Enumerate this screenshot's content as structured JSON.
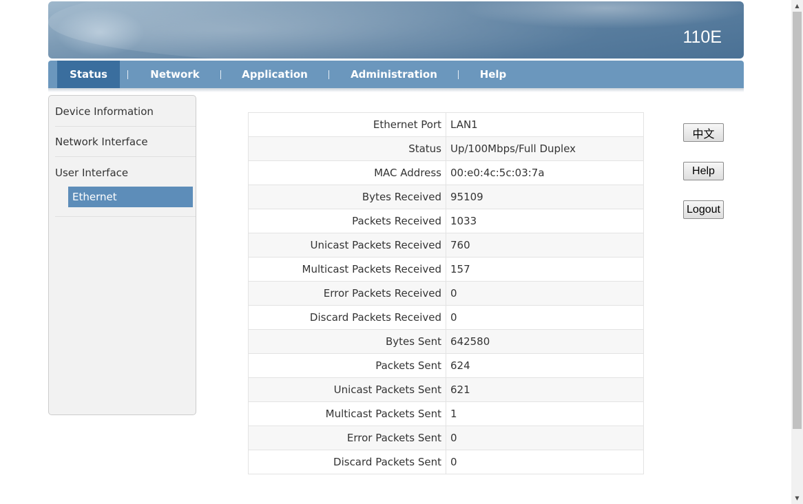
{
  "banner": {
    "model": "110E"
  },
  "nav": {
    "items": [
      {
        "label": "Status",
        "active": true
      },
      {
        "label": "Network"
      },
      {
        "label": "Application"
      },
      {
        "label": "Administration"
      },
      {
        "label": "Help"
      }
    ]
  },
  "sidebar": {
    "items": [
      "Device Information",
      "Network Interface",
      "User Interface"
    ],
    "sub_item": "Ethernet"
  },
  "stats": {
    "rows": [
      {
        "label": "Ethernet Port",
        "value": "LAN1"
      },
      {
        "label": "Status",
        "value": "Up/100Mbps/Full Duplex"
      },
      {
        "label": "MAC Address",
        "value": "00:e0:4c:5c:03:7a"
      },
      {
        "label": "Bytes Received",
        "value": "95109"
      },
      {
        "label": "Packets Received",
        "value": "1033"
      },
      {
        "label": "Unicast Packets Received",
        "value": "760"
      },
      {
        "label": "Multicast Packets Received",
        "value": "157"
      },
      {
        "label": "Error Packets Received",
        "value": "0"
      },
      {
        "label": "Discard Packets Received",
        "value": "0"
      },
      {
        "label": "Bytes Sent",
        "value": "642580"
      },
      {
        "label": "Packets Sent",
        "value": "624"
      },
      {
        "label": "Unicast Packets Sent",
        "value": "621"
      },
      {
        "label": "Multicast Packets Sent",
        "value": "1"
      },
      {
        "label": "Error Packets Sent",
        "value": "0"
      },
      {
        "label": "Discard Packets Sent",
        "value": "0"
      }
    ]
  },
  "buttons": {
    "language": "中文",
    "help": "Help",
    "logout": "Logout"
  },
  "colors": {
    "nav": "#6b97bd",
    "nav_active": "#3a6e9e",
    "sidebar_active": "#5d8db9"
  }
}
